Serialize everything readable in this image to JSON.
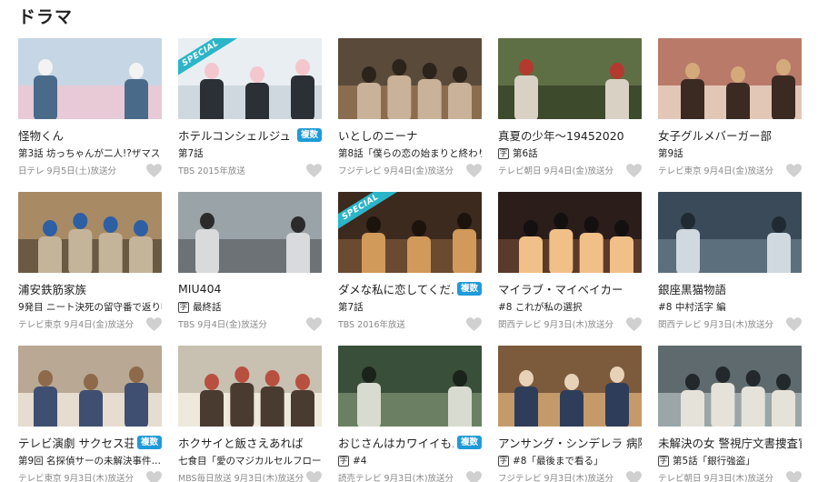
{
  "section_title": "ドラマ",
  "badge_fukusu": "複数",
  "badge_special": "SPECIAL",
  "subtitle_mark": "字",
  "colors": {
    "accent": "#1f9bd7",
    "special": "#2bb5c8",
    "heart": "#d0d0d0"
  },
  "items": [
    {
      "title": "怪物くん",
      "episode": "第3話 坊っちゃんが二人!?ザマス",
      "broadcast": "日テレ 9月5日(土)放送分",
      "fukusu": false,
      "special": false,
      "subtitled": false,
      "heart": "heart-icon"
    },
    {
      "title": "ホテルコンシェルジュ",
      "episode": "第7話",
      "broadcast": "TBS 2015年放送",
      "fukusu": true,
      "special": true,
      "subtitled": false,
      "heart": "heart-icon"
    },
    {
      "title": "いとしのニーナ",
      "episode": "第8話「僕らの恋の始まりと終わり」",
      "broadcast": "フジテレビ 9月4日(金)放送分",
      "fukusu": false,
      "special": false,
      "subtitled": false,
      "heart": "heart-icon"
    },
    {
      "title": "真夏の少年〜19452020",
      "episode": "第6話",
      "broadcast": "テレビ朝日 9月4日(金)放送分",
      "fukusu": false,
      "special": false,
      "subtitled": true,
      "heart": "heart-icon"
    },
    {
      "title": "女子グルメバーガー部",
      "episode": "第9話",
      "broadcast": "テレビ東京 9月4日(金)放送分",
      "fukusu": false,
      "special": false,
      "subtitled": false,
      "heart": "heart-icon"
    },
    {
      "title": "浦安鉄筋家族",
      "episode": "9発目 ニート決死の留守番で返り咲き!?",
      "broadcast": "テレビ東京 9月4日(金)放送分",
      "fukusu": false,
      "special": false,
      "subtitled": false,
      "heart": "heart-icon"
    },
    {
      "title": "MIU404",
      "episode": "最終話",
      "broadcast": "TBS 9月4日(金)放送分",
      "fukusu": false,
      "special": false,
      "subtitled": true,
      "heart": "heart-icon"
    },
    {
      "title": "ダメな私に恋してくだ…",
      "episode": "第7話",
      "broadcast": "TBS 2016年放送",
      "fukusu": true,
      "special": true,
      "subtitled": false,
      "heart": "heart-icon"
    },
    {
      "title": "マイラブ・マイベイカー",
      "episode": "#8 これが私の選択",
      "broadcast": "関西テレビ 9月3日(木)放送分",
      "fukusu": false,
      "special": false,
      "subtitled": false,
      "heart": "heart-icon"
    },
    {
      "title": "銀座黒猫物語",
      "episode": "#8 中村活字 編",
      "broadcast": "関西テレビ 9月3日(木)放送分",
      "fukusu": false,
      "special": false,
      "subtitled": false,
      "heart": "heart-icon"
    },
    {
      "title": "テレビ演劇 サクセス荘2",
      "episode": "第9回 名探偵サーの未解決事件…",
      "broadcast": "テレビ東京 9月3日(木)放送分",
      "fukusu": true,
      "special": false,
      "subtitled": false,
      "heart": "heart-icon"
    },
    {
      "title": "ホクサイと飯さえあれば",
      "episode": "七食目「愛のマジカルセルフロールキ…",
      "broadcast": "MBS毎日放送 9月3日(木)放送分",
      "fukusu": false,
      "special": false,
      "subtitled": false,
      "heart": "heart-icon"
    },
    {
      "title": "おじさんはカワイイも…",
      "episode": "#4",
      "broadcast": "読売テレビ 9月3日(木)放送分",
      "fukusu": true,
      "special": false,
      "subtitled": true,
      "heart": "heart-icon"
    },
    {
      "title": "アンサング・シンデレラ 病院…",
      "episode": "#8「最後まで看る」",
      "broadcast": "フジテレビ 9月3日(木)放送分",
      "fukusu": false,
      "special": false,
      "subtitled": true,
      "heart": "heart-icon"
    },
    {
      "title": "未解決の女 警視庁文書捜査官…",
      "episode": "第5話「銀行強盗」",
      "broadcast": "テレビ朝日 9月3日(木)放送分",
      "fukusu": false,
      "special": false,
      "subtitled": true,
      "heart": "heart-icon"
    }
  ]
}
